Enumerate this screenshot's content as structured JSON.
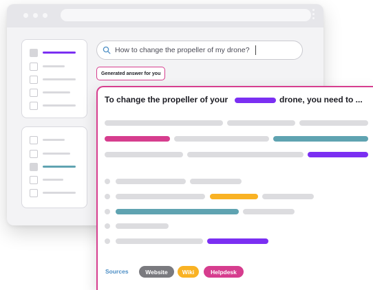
{
  "search": {
    "query": "How to change the propeller of my drone?"
  },
  "badge": {
    "label": "Generated answer for you"
  },
  "answer": {
    "title_before": "To change the propeller of your",
    "title_after": "drone, you need to ..."
  },
  "sources": {
    "label": "Sources",
    "tags": [
      {
        "label": "Website",
        "color": "#7a7a7f"
      },
      {
        "label": "Wiki",
        "color": "#f9b224"
      },
      {
        "label": "Helpdesk",
        "color": "#d63d8e"
      }
    ]
  },
  "colors": {
    "pink": "#d63d8e",
    "purple": "#7b2ff2",
    "teal": "#5fa3b1",
    "amber": "#f9b224",
    "placeholder": "#dcdcdf"
  },
  "icons": [
    "search-icon",
    "text-cursor-icon",
    "window-dot-icon",
    "kebab-menu-icon"
  ]
}
